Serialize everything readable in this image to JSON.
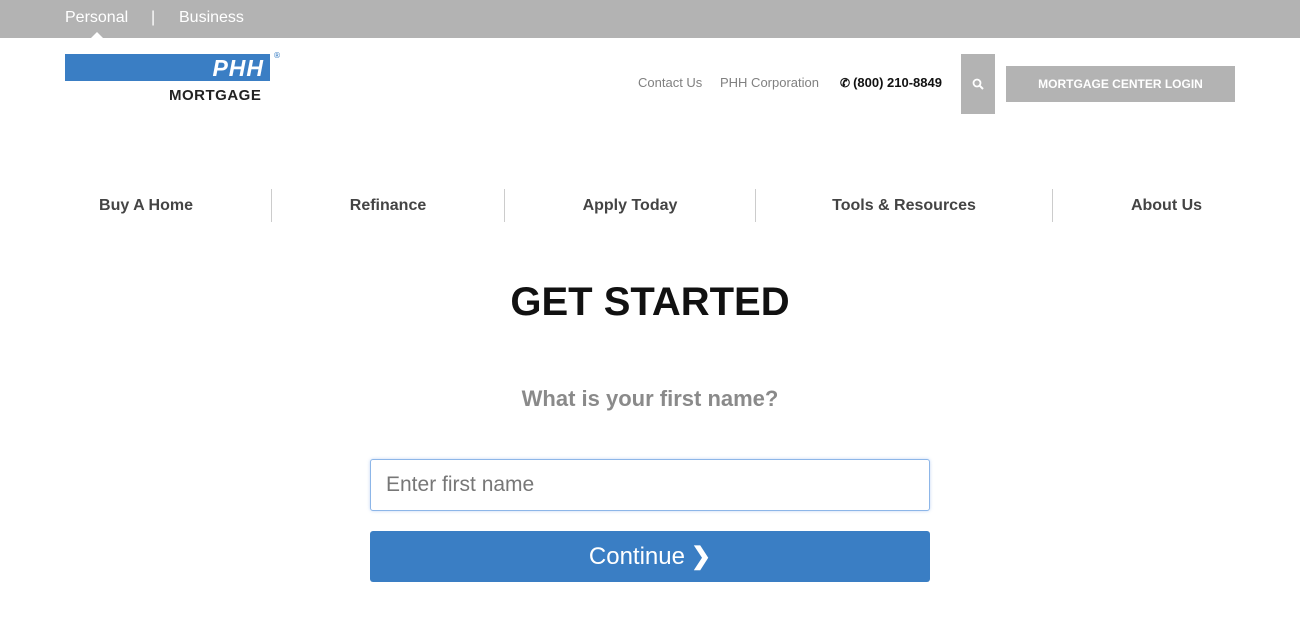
{
  "topbar": {
    "segments": [
      {
        "label": "Personal",
        "active": true
      },
      {
        "label": "Business",
        "active": false
      }
    ],
    "separator": "|"
  },
  "logo": {
    "brand": "PHH",
    "registered": "®",
    "sub": "MORTGAGE",
    "brand_color": "#3a7ec4"
  },
  "header": {
    "links": [
      {
        "label": "Contact Us"
      },
      {
        "label": "PHH Corporation"
      }
    ],
    "phone_icon": "phone-icon",
    "phone": "(800) 210-8849",
    "search_icon": "search-icon",
    "login_label": "MORTGAGE CENTER LOGIN"
  },
  "nav": {
    "items": [
      {
        "label": "Buy A Home"
      },
      {
        "label": "Refinance"
      },
      {
        "label": "Apply Today"
      },
      {
        "label": "Tools & Resources"
      },
      {
        "label": "About Us"
      }
    ]
  },
  "main": {
    "title": "GET STARTED",
    "question": "What is your first name?",
    "input": {
      "value": "",
      "placeholder": "Enter first name"
    },
    "continue_label": "Continue",
    "continue_icon": "chevron-right-icon",
    "accent_color": "#3a7ec4"
  }
}
